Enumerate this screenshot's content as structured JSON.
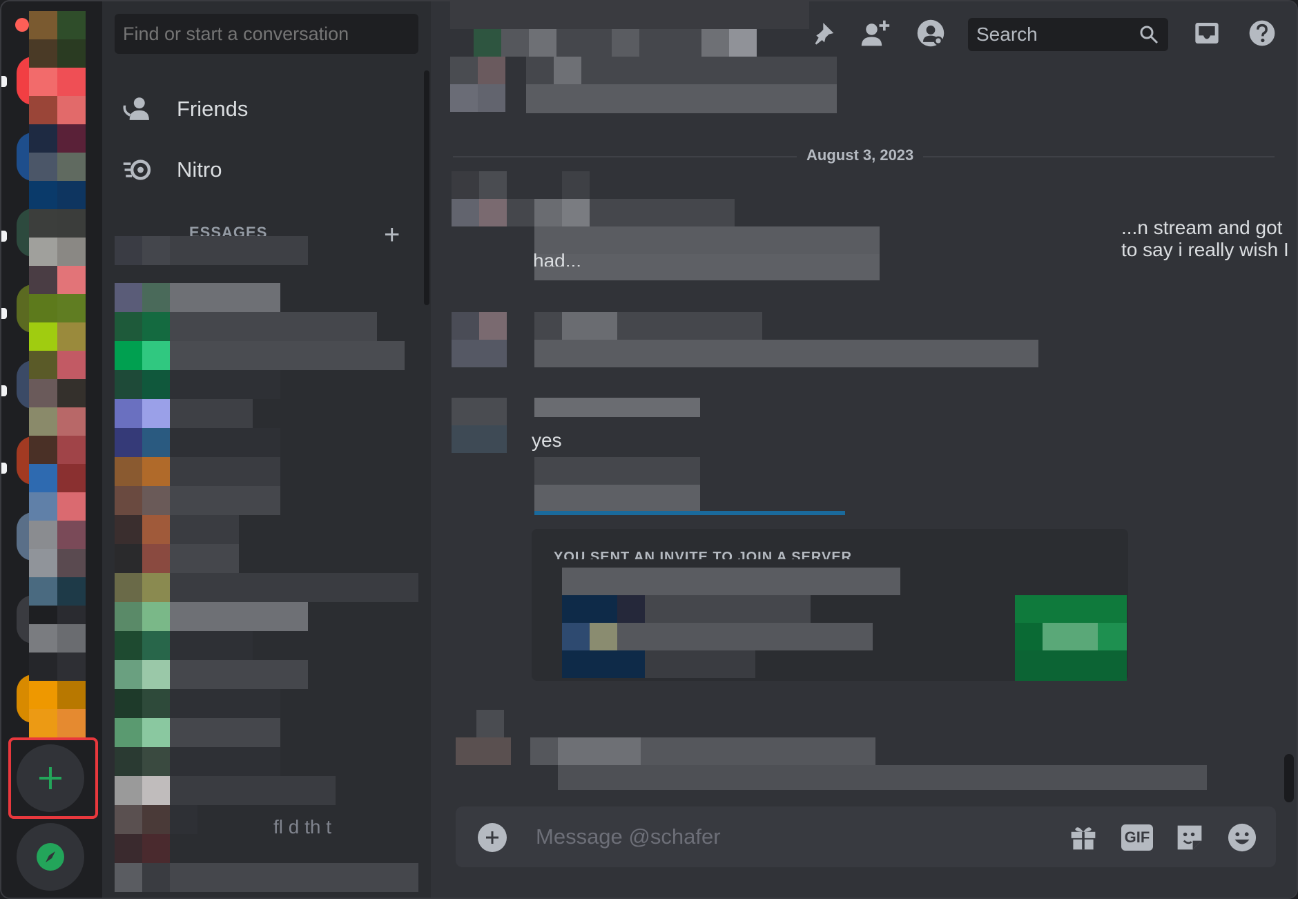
{
  "sidebar": {
    "search_placeholder": "Find or start a conversation",
    "nav": [
      {
        "label": "Friends",
        "icon": "friends-icon"
      },
      {
        "label": "Nitro",
        "icon": "nitro-icon"
      }
    ],
    "dm_header": "ESSAGES",
    "dm_add_label": "+",
    "dm_tail_text": "fl         d th  t"
  },
  "rail": {
    "add_server_icon": "plus-icon",
    "explore_icon": "compass-icon"
  },
  "toolbar": {
    "pin_icon": "pin-icon",
    "add_friend_icon": "add-friend-dm-icon",
    "profile_icon": "user-profile-icon",
    "search_placeholder": "Search",
    "inbox_icon": "inbox-icon",
    "help_icon": "help-icon"
  },
  "chat": {
    "date_divider": "August 3, 2023",
    "messages": [
      {
        "text_fragment": "...n stream and got to say i really wish I"
      },
      {
        "text_fragment": "had..."
      },
      {
        "text": "yes"
      }
    ],
    "invite_title": "YOU SENT AN INVITE TO JOIN A SERVER"
  },
  "composer": {
    "placeholder": "Message @schafer",
    "gif_label": "GIF",
    "icons": [
      "gift-icon",
      "gif-icon",
      "sticker-icon",
      "emoji-icon"
    ]
  },
  "colors": {
    "accent_green": "#23a55a",
    "highlight_red": "#e8383d"
  }
}
